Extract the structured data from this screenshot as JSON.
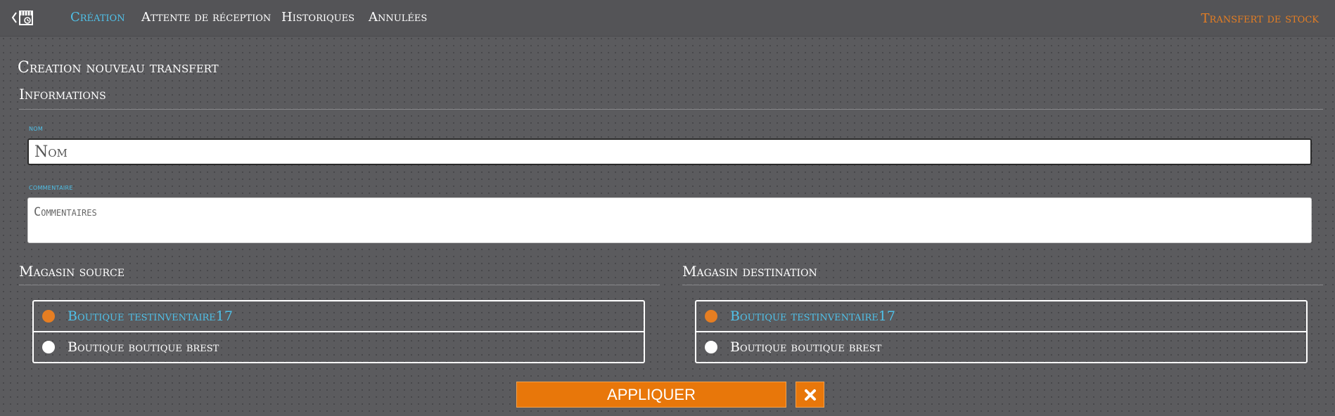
{
  "nav": {
    "items": [
      {
        "label": "Création",
        "active": true
      },
      {
        "label": "Attente de réception",
        "active": false
      },
      {
        "label": "Historiques",
        "active": false
      },
      {
        "label": "Annulées",
        "active": false
      }
    ],
    "right_label": "Transfert de stock",
    "back_icon": "back-store-icon"
  },
  "page": {
    "title": "Creation nouveau transfert",
    "section_info": "Informations"
  },
  "form": {
    "name_label": "nom",
    "name_placeholder": "Nom",
    "name_value": "",
    "comment_label": "commentaire",
    "comment_placeholder": "Commentaires",
    "comment_value": ""
  },
  "source": {
    "title": "Magasin source",
    "options": [
      {
        "label": "Boutique testinventaire17",
        "selected": true
      },
      {
        "label": "Boutique boutique brest",
        "selected": false
      }
    ]
  },
  "destination": {
    "title": "Magasin destination",
    "options": [
      {
        "label": "Boutique testinventaire17",
        "selected": true
      },
      {
        "label": "Boutique boutique brest",
        "selected": false
      }
    ]
  },
  "actions": {
    "apply_label": "APPLIQUER",
    "cancel_icon": "close-icon"
  },
  "colors": {
    "accent": "#e67e22",
    "link": "#4fc1e9",
    "background": "#5b5b5e"
  }
}
